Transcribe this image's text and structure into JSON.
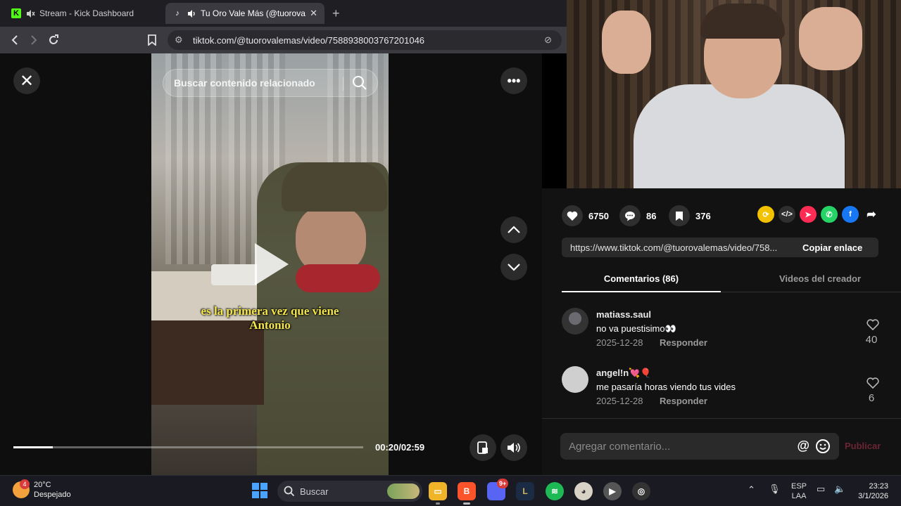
{
  "browser": {
    "tabs": [
      {
        "title": "Stream - Kick Dashboard",
        "active": false
      },
      {
        "title": "Tu Oro Vale Más (@tuorovale",
        "active": true
      }
    ],
    "url": "tiktok.com/@tuorovalemas/video/7588938003767201046"
  },
  "video": {
    "search_placeholder": "Buscar contenido relacionado",
    "caption_line1": "es la primera vez que viene",
    "caption_line2": "Antonio",
    "time": "00:20/02:59",
    "progress": 0.112
  },
  "post": {
    "likes": "6750",
    "comments": "86",
    "saves": "376",
    "link": "https://www.tiktok.com/@tuorovalemas/video/758...",
    "copy_label": "Copiar enlace",
    "tabs": [
      "Comentarios (86)",
      "Videos del creador"
    ],
    "comment_list": [
      {
        "user": "matiass.saul",
        "text": "no va puestisimo👀",
        "date": "2025-12-28",
        "reply": "Responder",
        "likes": "40"
      },
      {
        "user": "angel!n💘🎈",
        "text": "me pasaría horas viendo tus vides",
        "date": "2025-12-28",
        "reply": "Responder",
        "likes": "6"
      }
    ],
    "compose_placeholder": "Agregar comentario...",
    "publish_label": "Publicar",
    "accent_color": "#fe2c55"
  },
  "taskbar": {
    "weather_temp": "20°C",
    "weather_desc": "Despejado",
    "weather_badge": "4",
    "search_placeholder": "Buscar",
    "discord_badge": "9+",
    "lang_line1": "ESP",
    "lang_line2": "LAA",
    "time": "23:23",
    "date": "3/1/2026"
  }
}
